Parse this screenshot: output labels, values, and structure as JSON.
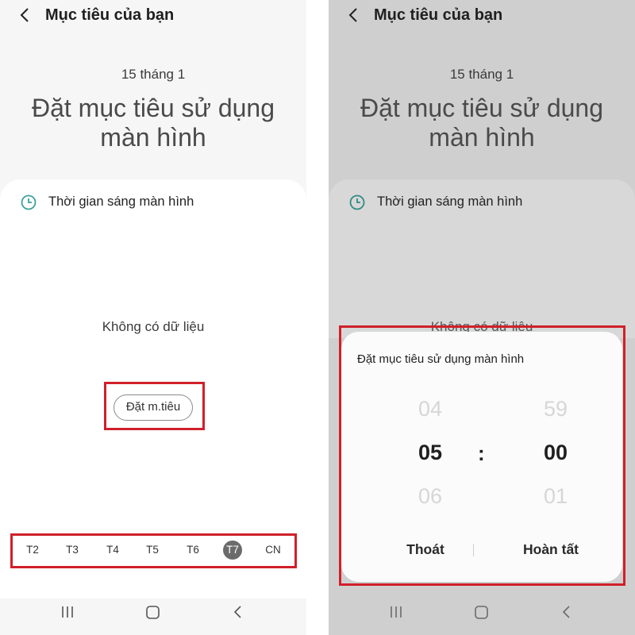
{
  "header": {
    "title": "Mục tiêu của bạn"
  },
  "date": "15 tháng 1",
  "big_title": "Đặt mục tiêu sử dụng màn hình",
  "screen_time_label": "Thời gian sáng màn hình",
  "no_data": "Không có dữ liệu",
  "set_goal_button": "Đặt m.tiêu",
  "days": [
    {
      "label": "T2",
      "active": false
    },
    {
      "label": "T3",
      "active": false
    },
    {
      "label": "T4",
      "active": false
    },
    {
      "label": "T5",
      "active": false
    },
    {
      "label": "T6",
      "active": false
    },
    {
      "label": "T7",
      "active": true
    },
    {
      "label": "CN",
      "active": false
    }
  ],
  "dialog": {
    "title": "Đặt mục tiêu sử dụng màn hình",
    "hours": {
      "prev": "04",
      "selected": "05",
      "next": "06"
    },
    "minutes": {
      "prev": "59",
      "selected": "00",
      "next": "01"
    },
    "separator": ":",
    "cancel_label": "Thoát",
    "done_label": "Hoàn tất"
  },
  "colors": {
    "highlight_box": "#d0202a",
    "clock_icon": "#3aa39a",
    "active_day": "#6b6b6b"
  },
  "icons": [
    "back-arrow-icon",
    "clock-icon",
    "recent-apps-icon",
    "home-icon",
    "back-nav-icon"
  ]
}
